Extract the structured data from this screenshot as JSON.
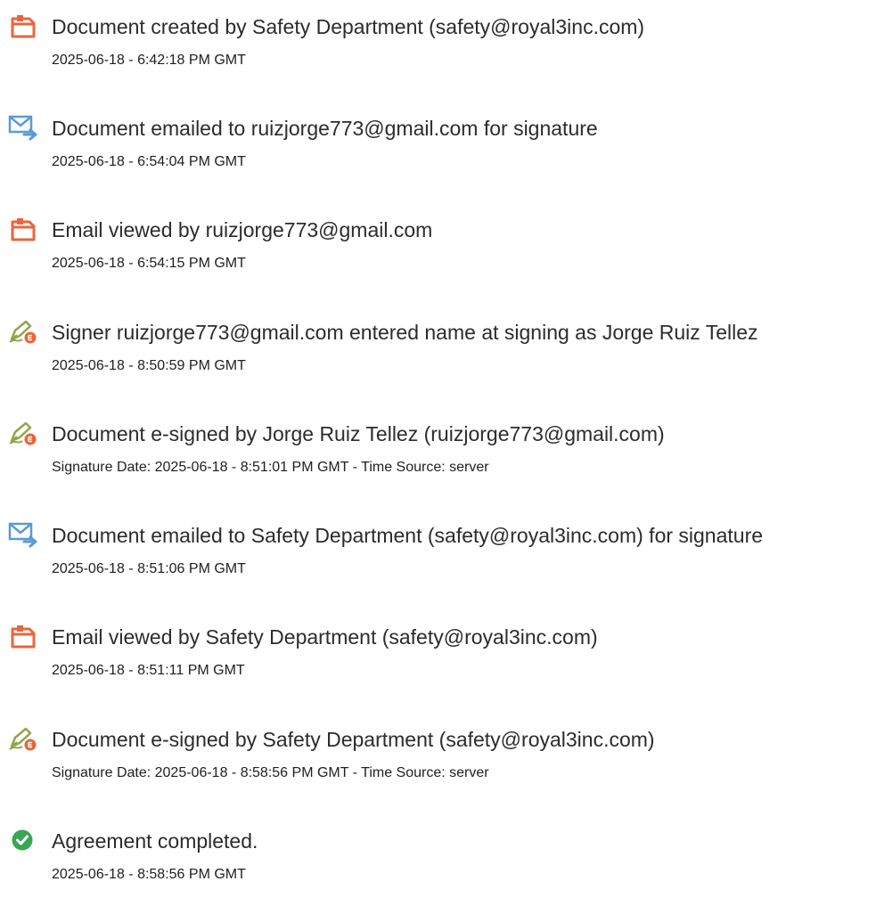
{
  "colors": {
    "pdf_icon": "#e8663d",
    "email_icon": "#5b9bd5",
    "esign_pen": "#8fa64a",
    "esign_badge": "#e8663d",
    "complete_check": "#3aa655",
    "text": "#2c2c2c"
  },
  "events": [
    {
      "icon": "document-icon",
      "title": "Document created by Safety Department (safety@royal3inc.com)",
      "detail": "2025-06-18 - 6:42:18 PM GMT"
    },
    {
      "icon": "email-sent-icon",
      "title": "Document emailed to ruizjorge773@gmail.com for signature",
      "detail": "2025-06-18 - 6:54:04 PM GMT"
    },
    {
      "icon": "document-icon",
      "title": "Email viewed by ruizjorge773@gmail.com",
      "detail": "2025-06-18 - 6:54:15 PM GMT"
    },
    {
      "icon": "esign-pen-icon",
      "title": "Signer ruizjorge773@gmail.com entered name at signing as Jorge Ruiz Tellez",
      "detail": "2025-06-18 - 8:50:59 PM GMT"
    },
    {
      "icon": "esign-pen-icon",
      "title": "Document e-signed by Jorge Ruiz Tellez (ruizjorge773@gmail.com)",
      "detail": "Signature Date: 2025-06-18 - 8:51:01 PM GMT - Time Source: server"
    },
    {
      "icon": "email-sent-icon",
      "title": "Document emailed to Safety Department (safety@royal3inc.com) for signature",
      "detail": "2025-06-18 - 8:51:06 PM GMT"
    },
    {
      "icon": "document-icon",
      "title": "Email viewed by Safety Department (safety@royal3inc.com)",
      "detail": "2025-06-18 - 8:51:11 PM GMT"
    },
    {
      "icon": "esign-pen-icon",
      "title": "Document e-signed by Safety Department (safety@royal3inc.com)",
      "detail": "Signature Date: 2025-06-18 - 8:58:56 PM GMT - Time Source: server"
    },
    {
      "icon": "check-circle-icon",
      "title": "Agreement completed.",
      "detail": "2025-06-18 - 8:58:56 PM GMT"
    }
  ]
}
